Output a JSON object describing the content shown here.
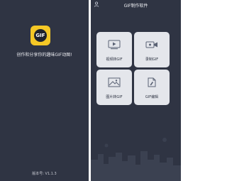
{
  "splash": {
    "logo_text": "GIF",
    "tagline": "创作和分享你的趣味GIF动图!",
    "version": "版本号: V1.1.3"
  },
  "app": {
    "title": "GIF制作软件",
    "tiles": [
      {
        "label": "视频转GIF",
        "icon": "video-play-icon"
      },
      {
        "label": "录制GIF",
        "icon": "camera-record-icon"
      },
      {
        "label": "图片转GIF",
        "icon": "image-icon"
      },
      {
        "label": "GIF编辑",
        "icon": "edit-file-icon"
      }
    ]
  },
  "colors": {
    "background": "#2f3443",
    "tile": "#e4e6eb",
    "logo_yellow": "#f5c826",
    "accent_icon": "#5a6274"
  }
}
